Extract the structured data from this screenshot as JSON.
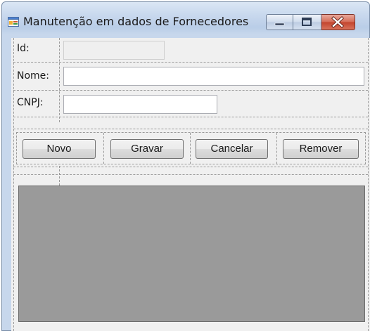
{
  "window": {
    "title": "Manutenção em dados de Fornecedores"
  },
  "form": {
    "id_label": "Id:",
    "id_value": "",
    "nome_label": "Nome:",
    "nome_value": "",
    "cnpj_label": "CNPJ:",
    "cnpj_value": ""
  },
  "buttons": {
    "novo": "Novo",
    "gravar": "Gravar",
    "cancelar": "Cancelar",
    "remover": "Remover"
  },
  "icons": {
    "app": "form-window-icon",
    "minimize": "minimize-icon",
    "maximize": "maximize-icon",
    "close": "close-icon"
  },
  "colors": {
    "close_button": "#c8463a",
    "grid_background": "#9a9a9a"
  }
}
